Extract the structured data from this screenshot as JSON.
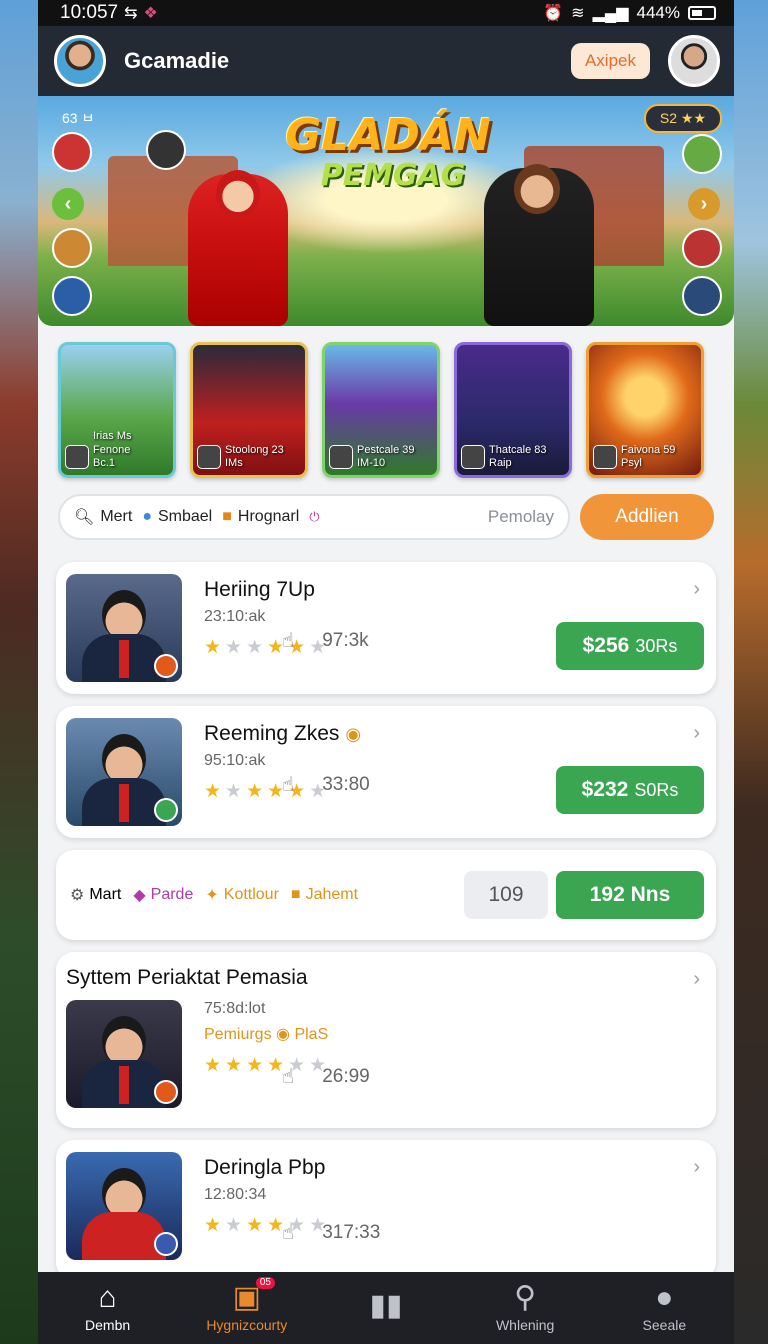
{
  "status_bar": {
    "time": "10:057",
    "battery": "444%"
  },
  "header": {
    "title": "Gcamadie",
    "action_label": "Axipek"
  },
  "banner": {
    "title": "GLADÁN",
    "subtitle": "PEMGAG",
    "tag": "63 ㅂ",
    "stat": "S2 ★★"
  },
  "games": [
    {
      "label_line1": "Irias Ms Fenone",
      "label_line2": "Bc.1"
    },
    {
      "label_line1": "Stoolong 23",
      "label_line2": "IMs"
    },
    {
      "label_line1": "Pestcale 39",
      "label_line2": "IM-10"
    },
    {
      "label_line1": "Thatcale 83",
      "label_line2": "Raip"
    },
    {
      "label_line1": "Faivona 59",
      "label_line2": "Psyl"
    }
  ],
  "search": {
    "chips": [
      "Mert",
      "Smbael",
      "Hrognarl"
    ],
    "placeholder": "Pemolay",
    "button_label": "Addlien"
  },
  "items": [
    {
      "title": "Heriing 7Up",
      "subtitle": "23:10:ak",
      "stars_on": 4,
      "meta": "97:3k",
      "price": "$256",
      "price_unit": "30Rs"
    },
    {
      "title": "Reeming Zkes",
      "subtitle": "95:10:ak",
      "stars_on": 4,
      "meta": "33:80",
      "price": "$232",
      "price_unit": "S0Rs"
    }
  ],
  "filter_row": {
    "chips": [
      "Mart",
      "Parde",
      "Kottlour",
      "Jahemt"
    ],
    "count": "109",
    "button_label": "192 Nns"
  },
  "featured": {
    "title": "Syttem Periaktat Pemasia",
    "subtitle": "75:8d:lot",
    "tag": "Pemiurgs",
    "tag2": "PlaS",
    "stars_on": 4,
    "meta": "26:99"
  },
  "last_item": {
    "title": "Deringla Pbp",
    "subtitle": "12:80:34",
    "stars_on": 3,
    "meta": "317:33"
  },
  "bottom_nav": [
    {
      "label": "Dembn",
      "icon": "home-icon"
    },
    {
      "label": "Hygnizcourty",
      "icon": "gamepad-icon",
      "badge": "05"
    },
    {
      "label": "",
      "icon": "cards-icon"
    },
    {
      "label": "Whlening",
      "icon": "search-icon"
    },
    {
      "label": "Seeale",
      "icon": "profile-icon"
    }
  ],
  "colors": {
    "accent_orange": "#f0953a",
    "price_green": "#3aa651",
    "header_bg": "#242a33",
    "nav_bg": "#1e2025"
  }
}
